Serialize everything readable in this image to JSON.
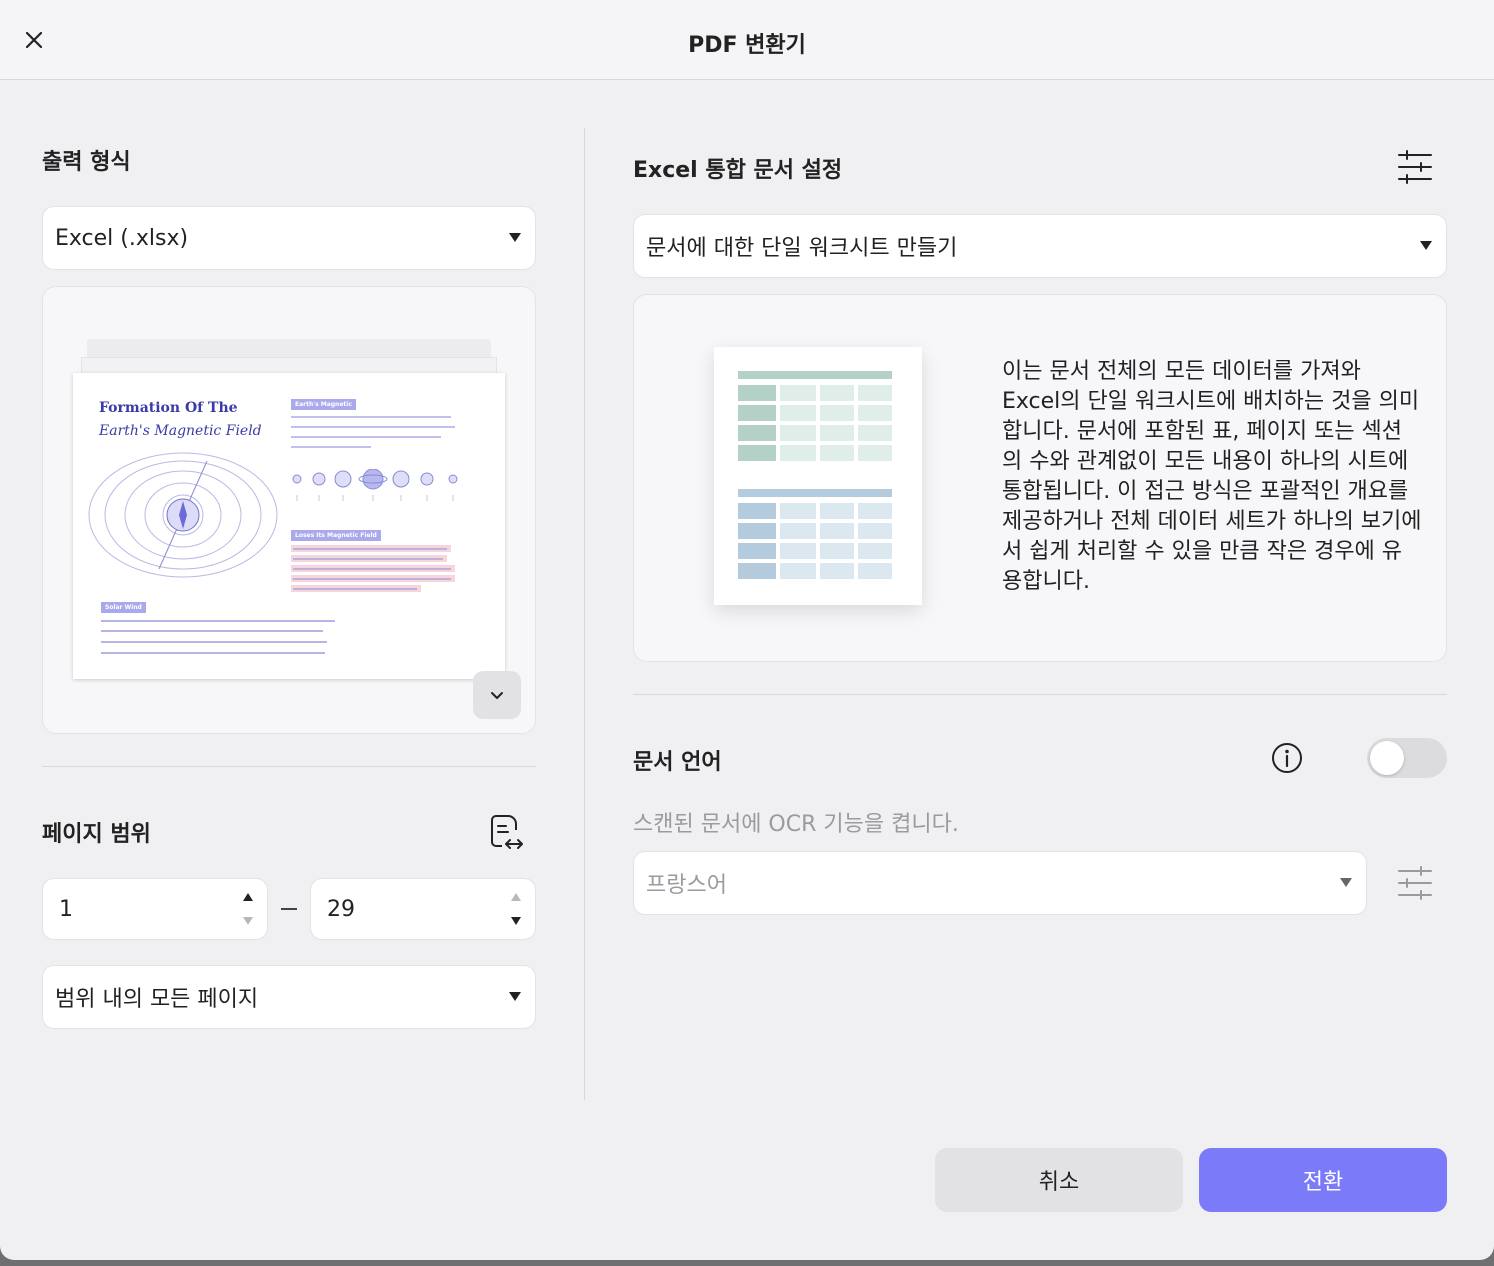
{
  "header": {
    "title": "PDF 변환기"
  },
  "left": {
    "output_format_title": "출력 형식",
    "output_format_value": "Excel (.xlsx)",
    "preview": {
      "doc_title_line1": "Formation Of The",
      "doc_title_line2": "Earth's Magnetic Field",
      "tag_magnetic": "Earth's Magnetic",
      "tag_loses": "Loses Its Magnetic Field",
      "tag_solar": "Solar Wind"
    },
    "page_range_title": "페이지 범위",
    "range_from": "1",
    "range_to": "29",
    "range_subset_value": "범위 내의 모든 페이지"
  },
  "right": {
    "excel_settings_title": "Excel 통합 문서 설정",
    "worksheet_mode_value": "문서에 대한 단일 워크시트 만들기",
    "description": "이는 문서 전체의 모든 데이터를 가져와 Excel의 단일 워크시트에 배치하는 것을 의미합니다. 문서에 포함된 표, 페이지 또는 섹션의 수와 관계없이 모든 내용이 하나의 시트에 통합됩니다. 이 접근 방식은 포괄적인 개요를 제공하거나 전체 데이터 세트가 하나의 보기에서 쉽게 처리할 수 있을 만큼 작은 경우에 유용합니다.",
    "doc_language_title": "문서 언어",
    "ocr_description": "스캔된 문서에 OCR 기능을 켭니다.",
    "language_value": "프랑스어",
    "ocr_enabled": false
  },
  "footer": {
    "cancel_label": "취소",
    "convert_label": "전환"
  },
  "colors": {
    "accent": "#7b7bfa",
    "green_sheet": "#b3d1c6",
    "blue_sheet": "#b3cbdc"
  }
}
